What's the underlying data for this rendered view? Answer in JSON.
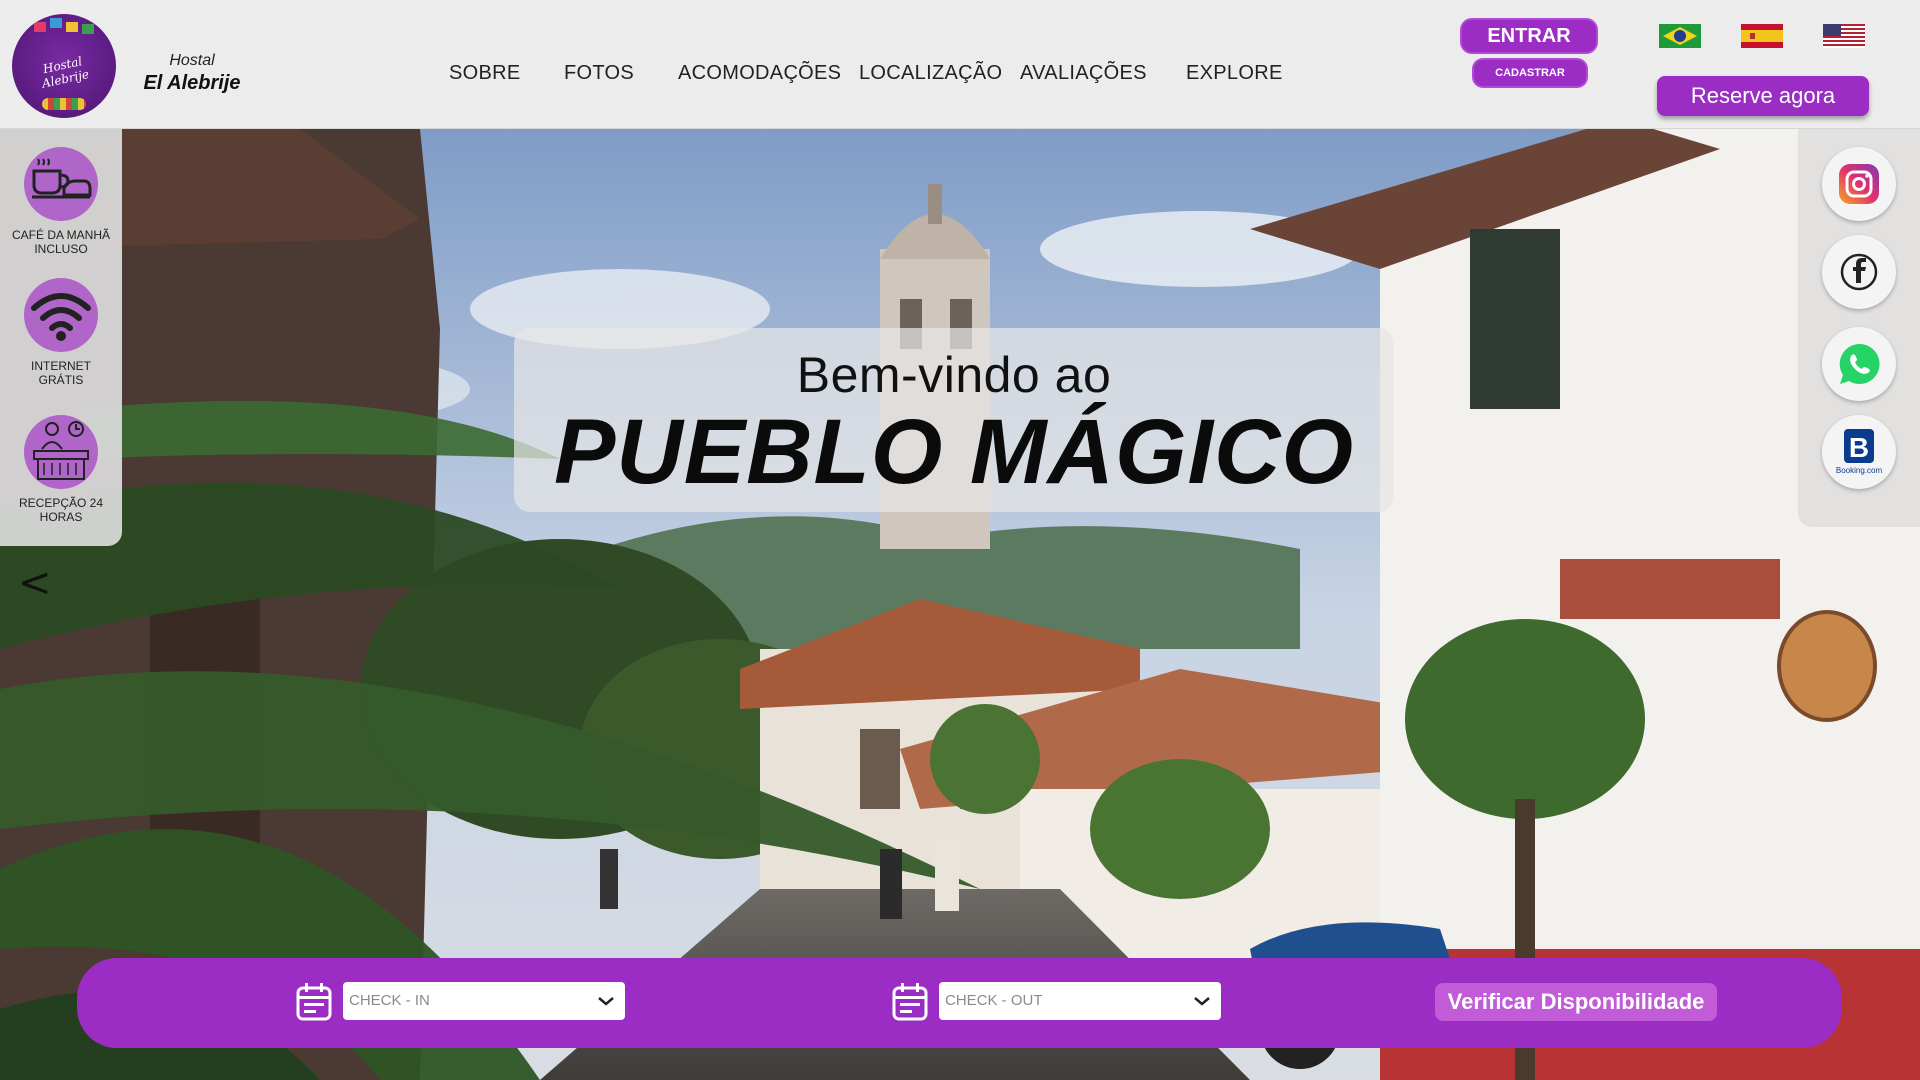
{
  "brand": {
    "logo_text": "Hostal Alebrije",
    "small": "Hostal",
    "name": "El Alebrije"
  },
  "nav": {
    "items": [
      {
        "label": "SOBRE"
      },
      {
        "label": "FOTOS"
      },
      {
        "label": "ACOMODAÇÕES"
      },
      {
        "label": "LOCALIZAÇÃO"
      },
      {
        "label": "AVALIAÇÕES"
      },
      {
        "label": "EXPLORE"
      }
    ]
  },
  "auth": {
    "login_label": "ENTRAR",
    "signup_label": "CADASTRAR",
    "reserve_label": "Reserve agora"
  },
  "languages": [
    {
      "icon": "flag-brazil-icon"
    },
    {
      "icon": "flag-spain-icon"
    },
    {
      "icon": "flag-usa-icon"
    }
  ],
  "amenities": [
    {
      "icon": "coffee-breakfast-icon",
      "label_line1": "CAFÉ DA MANHÃ",
      "label_line2": "INCLUSO"
    },
    {
      "icon": "wifi-icon",
      "label_line1": "INTERNET",
      "label_line2": "GRÁTIS"
    },
    {
      "icon": "reception-desk-icon",
      "label_line1": "RECEPÇÃO 24",
      "label_line2": "HORAS"
    }
  ],
  "carousel": {
    "prev_icon": "chevron-left-icon",
    "prev_glyph": "<"
  },
  "social": [
    {
      "icon": "instagram-icon"
    },
    {
      "icon": "facebook-icon"
    },
    {
      "icon": "whatsapp-icon"
    },
    {
      "icon": "booking-icon",
      "text": "B",
      "caption": "Booking.com"
    }
  ],
  "hero": {
    "line1": "Bem-vindo ao",
    "line2": "PUEBLO MÁGICO"
  },
  "booking": {
    "checkin_placeholder": "CHECK - IN",
    "checkout_placeholder": "CHECK - OUT",
    "verify_label": "Verificar Disponibilidade"
  },
  "colors": {
    "accent": "#9b2dc4",
    "accent_light": "#c15bd8",
    "amenity_circle": "#b065c9",
    "header_bg": "#ececec"
  }
}
